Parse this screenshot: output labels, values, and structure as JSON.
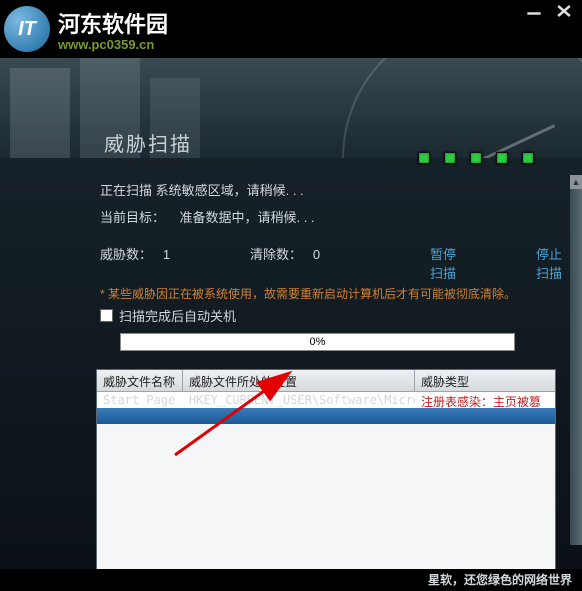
{
  "brand": {
    "logo_text": "IT",
    "title": "河东软件园",
    "url": "www.pc0359.cn"
  },
  "window": {
    "minimize": "—",
    "close": "✕"
  },
  "page": {
    "title": "威胁扫描"
  },
  "scan": {
    "status_line": "正在扫描 系统敏感区域，请稍候. . .",
    "target_label": "当前目标：",
    "target_value": "准备数据中，请稍候. . .",
    "threat_count_label": "威胁数：",
    "threat_count_value": "1",
    "clean_count_label": "清除数：",
    "clean_count_value": "0",
    "pause_link": "暂停扫描",
    "stop_link": "停止扫描",
    "warning": "* 某些威胁因正在被系统使用，故需要重新启动计算机后才有可能被彻底清除。",
    "shutdown_checkbox_label": "扫描完成后自动关机",
    "progress_text": "0%"
  },
  "table": {
    "headers": [
      "威胁文件名称",
      "威胁文件所处的位置",
      "威胁类型"
    ],
    "rows": [
      {
        "name": "Start Page",
        "path": "HKEY_CURRENT_USER\\Software\\Microsoft\\In",
        "type": "注册表感染：主页被篡"
      }
    ]
  },
  "footer": {
    "text": "星软，还您绿色的网络世界"
  }
}
